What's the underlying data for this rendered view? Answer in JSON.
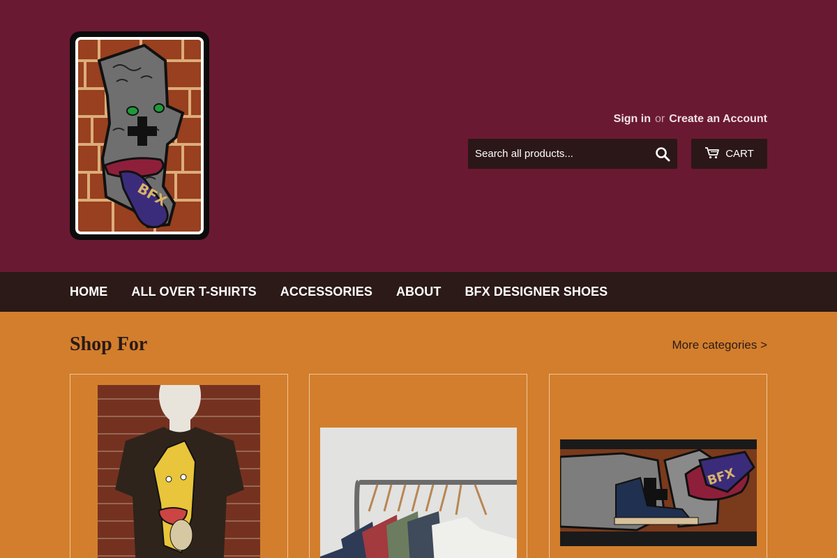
{
  "header": {
    "logo_alt": "BFX",
    "sign_in": "Sign in",
    "or": "or",
    "create_account": "Create an Account",
    "search_placeholder": "Search all products...",
    "cart_label": "CART"
  },
  "nav": {
    "items": [
      "HOME",
      "ALL OVER T-SHIRTS",
      "ACCESSORIES",
      "ABOUT",
      "BFX DESIGNER SHOES"
    ]
  },
  "main": {
    "section_title": "Shop For",
    "more_categories": "More categories >"
  },
  "colors": {
    "header_bg": "#6a1932",
    "nav_bg": "#2b1a17",
    "body_bg": "#d37e2c",
    "button_bg": "#2b1717"
  }
}
